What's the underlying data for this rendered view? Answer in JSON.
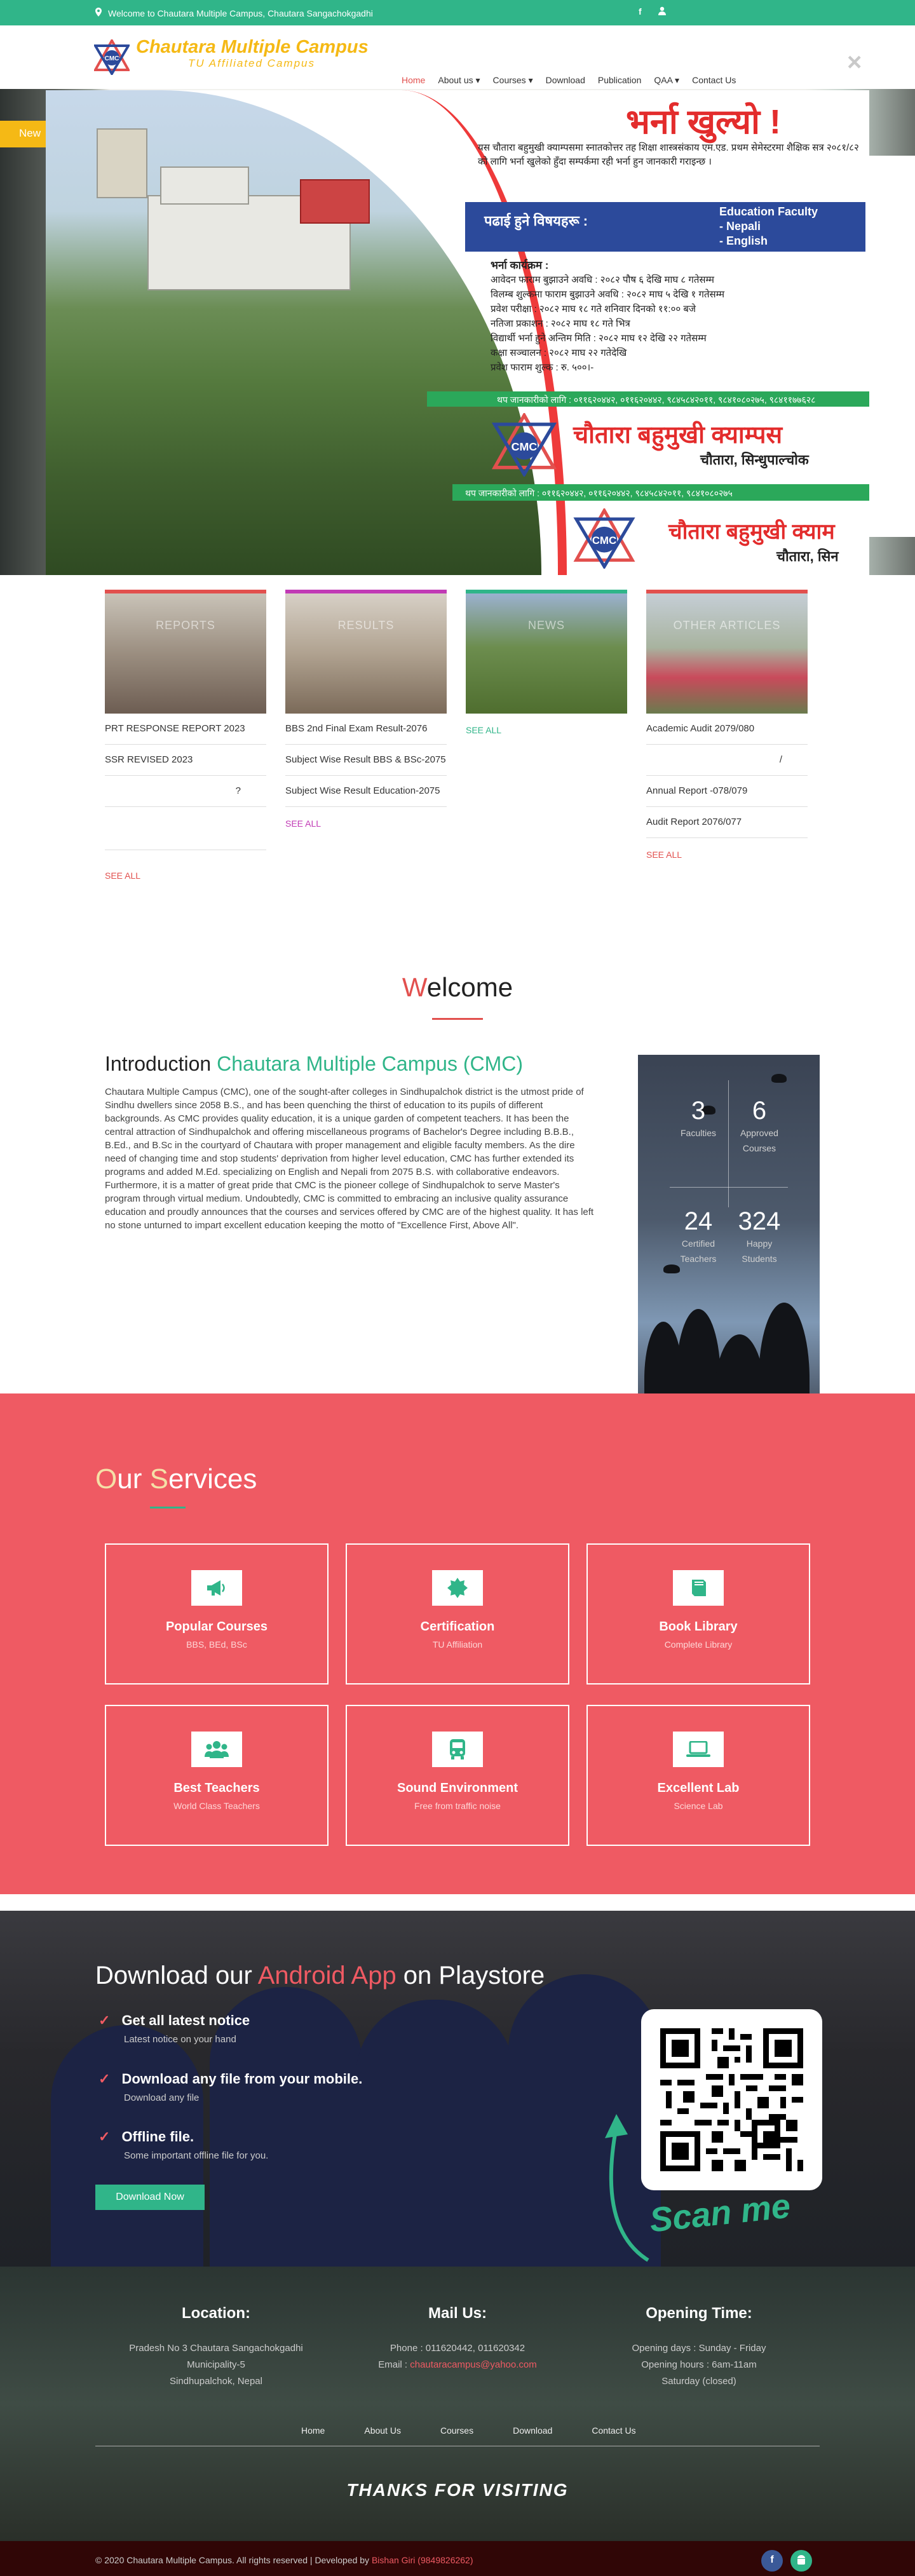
{
  "topbar": {
    "welcome": "Welcome to Chautara Multiple Campus, Chautara Sangachokgadhi",
    "facebook": "f",
    "user": "♣"
  },
  "header": {
    "name": "Chautara Multiple Campus",
    "sub": "TU Affiliated Campus",
    "close": "×",
    "nav": [
      "Home",
      "About us ▾",
      "Courses ▾",
      "Download",
      "Publication",
      "QAA ▾",
      "Contact Us"
    ]
  },
  "hero": {
    "news_tab": "New",
    "popup_title": "भर्ना खुल्यो !",
    "popup_intro": "यस चौतारा बहुमुखी क्याम्पसमा स्नातकोत्तर तह शिक्षा शास्त्रसंकाय एम.एड. प्रथम सेमेस्टरमा शैक्षिक सत्र २०८१/८२ को लागि भर्ना खुलेको हुँदा सम्पर्कमा रही भर्ना हुन जानकारी गराइन्छ ।",
    "subjects_label": "पढाई हुने विषयहरू :",
    "subjects": [
      "Education Faculty",
      "- Nepali",
      "- English"
    ],
    "schedule_title": "भर्ना कार्यक्रम :",
    "schedule": [
      "आवेदन फाराम बुझाउने अवधि : २०८२ पौष ६ देखि माघ ८ गतेसम्म",
      "विलम्ब शुल्कमा फाराम बुझाउने अवधि : २०८२ माघ ५ देखि १ गतेसम्म",
      "प्रवेश परीक्षा : २०८२ माघ १८ गते शनिवार दिनको ११:०० बजे",
      "नतिजा प्रकाशन : २०८२ माघ १८ गते भित्र",
      "विद्यार्थी भर्ना हुने अन्तिम मिति : २०८२ माघ १२ देखि २२ गतेसम्म",
      "कक्षा सञ्चालन : २०८२ माघ २२ गतेदेखि",
      "प्रवेश फाराम शुल्क : रु. ५००।-"
    ],
    "contact": "थप जानकारीको लागि : ०११६२०४४२, ०११६२०४४२, ९८४५८४२०११, ९८४१०८०२७५, ९८४११७७६२८",
    "campus_name": "चौतारा बहुमुखी क्याम्पस",
    "campus_place": "चौतारा, सिन्धुपाल्चोक",
    "contact2": "थप जानकारीको लागि : ०११६२०४४२, ०११६२०४४२, ९८४५८४२०११, ९८४१०८०२७५",
    "campus_name2": "चौतारा बहुमुखी क्याम",
    "campus_place2": "चौतारा, सिन"
  },
  "cards": [
    {
      "color": "#e2504e",
      "label": "REPORTS",
      "items": [
        "PRT RESPONSE REPORT 2023",
        "SSR REVISED 2023",
        "?",
        ""
      ],
      "see": "SEE ALL"
    },
    {
      "color": "#c13ab5",
      "label": "RESULTS",
      "items": [
        "BBS 2nd Final Exam Result-2076",
        "Subject Wise Result BBS & BSc-2075",
        "Subject Wise Result Education-2075"
      ],
      "see": "SEE ALL"
    },
    {
      "color": "#30b589",
      "label": "NEWS",
      "items": [],
      "see": "SEE ALL"
    },
    {
      "color": "#e2504e",
      "label": "OTHER ARTICLES",
      "items": [
        "Academic Audit 2079/080",
        "/",
        "Annual Report -078/079",
        "Audit Report 2076/077"
      ],
      "see": "SEE ALL"
    }
  ],
  "welcome": {
    "first": "W",
    "rest": "elcome",
    "intro_lead": "Introduction",
    "intro_name": "Chautara Multiple Campus (CMC)",
    "body": "Chautara Multiple Campus (CMC), one of the sought-after colleges in Sindhupalchok district is the utmost pride of Sindhu dwellers since 2058 B.S., and has been quenching the thirst of education to its pupils of different backgrounds. As CMC provides quality education, it is a unique garden of competent teachers. It has been the central attraction of Sindhupalchok and offering miscellaneous programs of Bachelor's Degree including B.B.B., B.Ed., and B.Sc in the courtyard of Chautara with proper management and eligible faculty members. As the dire need of changing time and stop students' deprivation from higher level education, CMC has further extended its programs and added M.Ed. specializing on English and Nepali from 2075 B.S. with collaborative endeavors. Furthermore, it is a matter of great pride that CMC is the pioneer college of Sindhupalchok to serve Master's program through virtual medium. Undoubtedly, CMC is committed to embracing an inclusive quality assurance education and proudly announces that the courses and services offered by CMC are of the highest quality. It has left no stone unturned to impart excellent education keeping the motto of \"Excellence First, Above All\"."
  },
  "stats": [
    {
      "n": "3",
      "l": "Faculties"
    },
    {
      "n": "6",
      "l": "Approved Courses"
    },
    {
      "n": "24",
      "l": "Certified Teachers"
    },
    {
      "n": "324",
      "l": "Happy Students"
    }
  ],
  "services": {
    "t1": "O",
    "t2": "ur ",
    "t3": "S",
    "t4": "ervices",
    "items": [
      {
        "icon": "megaphone-icon",
        "glyph": "📢",
        "title": "Popular Courses",
        "sub": "BBS, BEd, BSc"
      },
      {
        "icon": "certificate-icon",
        "glyph": "✹",
        "title": "Certification",
        "sub": "TU Affiliation"
      },
      {
        "icon": "book-icon",
        "glyph": "📗",
        "title": "Book Library",
        "sub": "Complete Library"
      },
      {
        "icon": "users-icon",
        "glyph": "👥",
        "title": "Best Teachers",
        "sub": "World Class Teachers"
      },
      {
        "icon": "bus-icon",
        "glyph": "🚌",
        "title": "Sound Environment",
        "sub": "Free from traffic noise"
      },
      {
        "icon": "laptop-icon",
        "glyph": "💻",
        "title": "Excellent Lab",
        "sub": "Science Lab"
      }
    ]
  },
  "app": {
    "t1": "Download our ",
    "t2": "Android App",
    "t3": " on Playstore",
    "items": [
      {
        "t": "Get all latest notice",
        "s": "Latest notice on your hand"
      },
      {
        "t": "Download any file from your mobile.",
        "s": "Download any file"
      },
      {
        "t": "Offline file.",
        "s": "Some important offline file for you."
      }
    ],
    "button": "Download Now",
    "scan": "Scan me"
  },
  "footer": {
    "location": {
      "h": "Location:",
      "lines": [
        "Pradesh No 3 Chautara Sangachokgadhi",
        "Municipality-5",
        "Sindhupalchok, Nepal"
      ]
    },
    "mail": {
      "h": "Mail Us:",
      "phone": "Phone : 011620442, 011620342",
      "email_label": "Email : ",
      "email": "chautaracampus@yahoo.com"
    },
    "time": {
      "h": "Opening Time:",
      "lines": [
        "Opening days : Sunday - Friday",
        "Opening hours : 6am-11am",
        "Saturday (closed)"
      ]
    },
    "nav": [
      "Home",
      "About Us",
      "Courses",
      "Download",
      "Contact Us"
    ],
    "thanks": "THANKS FOR VISITING",
    "copy": "© 2020 Chautara Multiple Campus. All rights reserved | Developed by ",
    "dev": "Bishan Giri (9849826262)"
  },
  "colors": {
    "green": "#30b589",
    "red": "#e2504e",
    "gold": "#f5b915",
    "services_bg": "#ef5a63"
  }
}
